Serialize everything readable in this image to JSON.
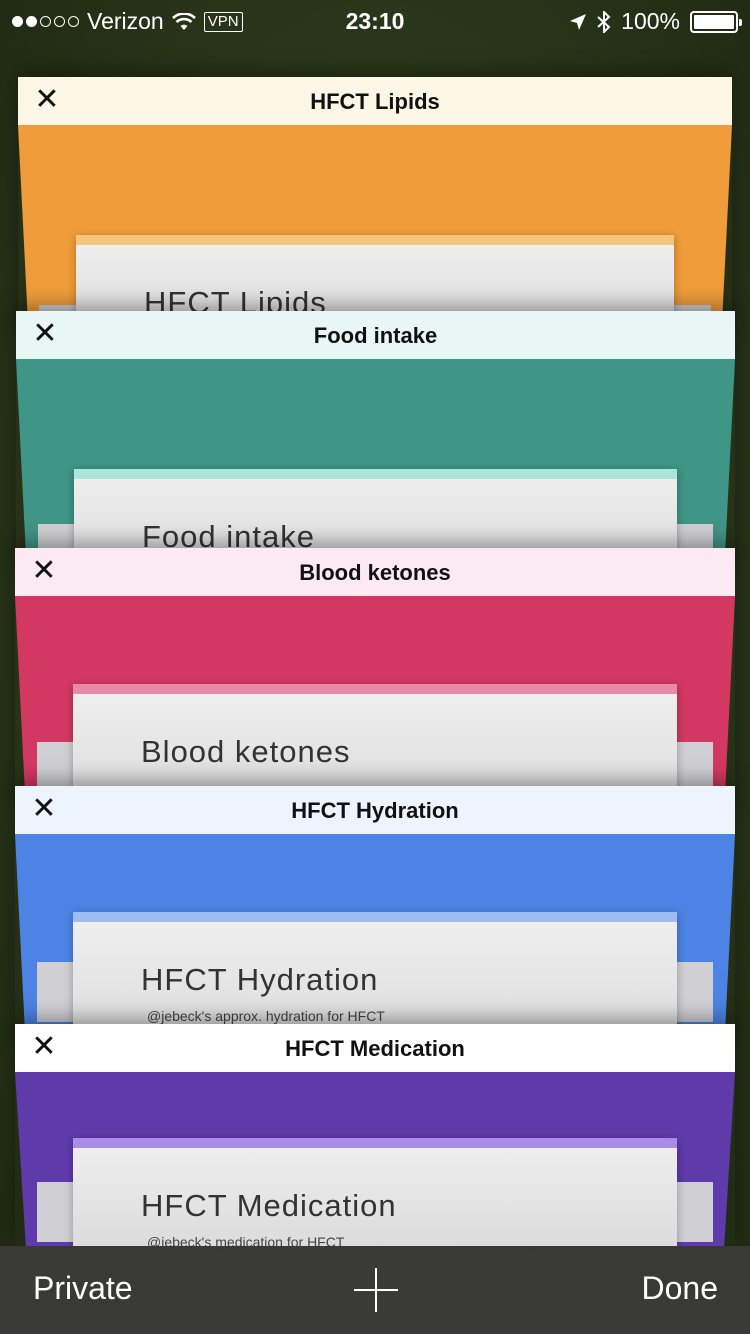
{
  "status_bar": {
    "carrier": "Verizon",
    "vpn": "VPN",
    "time": "23:10",
    "battery": "100%"
  },
  "tabs": [
    {
      "close": "✕",
      "title": "HFCT Lipids",
      "heading": "HFCT Lipids",
      "subtitle": "",
      "bar_color": "#fcf6e6",
      "page_color": "#f09c3a",
      "accent_color": "#f3c57e"
    },
    {
      "close": "✕",
      "title": "Food intake",
      "heading": "Food intake",
      "subtitle": "",
      "bar_color": "#e9f6f6",
      "page_color": "#3f9586",
      "accent_color": "#a9e8d6"
    },
    {
      "close": "✕",
      "title": "Blood ketones",
      "heading": "Blood ketones",
      "subtitle": "",
      "bar_color": "#fbeaf2",
      "page_color": "#d33862",
      "accent_color": "#e98aa6"
    },
    {
      "close": "✕",
      "title": "HFCT Hydration",
      "heading": "HFCT Hydration",
      "subtitle": "@jebeck's approx. hydration for HFCT",
      "bar_color": "#eef4fd",
      "page_color": "#4d83e4",
      "accent_color": "#9dbcf2"
    },
    {
      "close": "✕",
      "title": "HFCT Medication",
      "heading": "HFCT Medication",
      "subtitle": "@jebeck's medication for HFCT",
      "bar_color": "#ffffff",
      "page_color": "#5f3aaa",
      "accent_color": "#a78de6"
    }
  ],
  "toolbar": {
    "private_label": "Private",
    "done_label": "Done"
  }
}
